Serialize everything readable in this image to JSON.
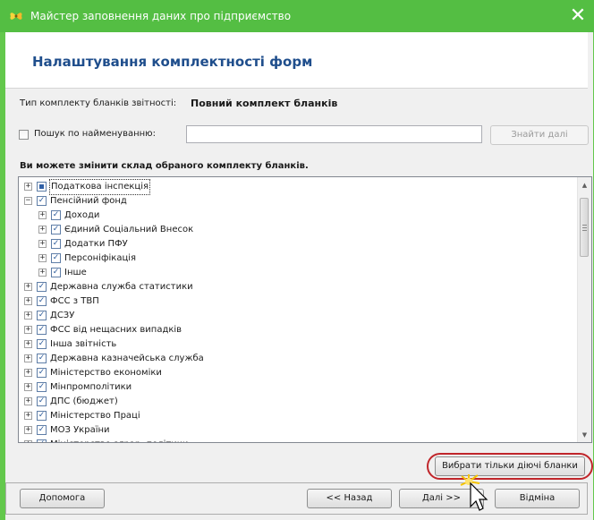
{
  "window": {
    "title": "Майстер заповнення даних про підприємство",
    "close_glyph": "✕",
    "accent_color": "#54be43"
  },
  "header": {
    "title": "Налаштування комплектності форм"
  },
  "kit": {
    "label": "Тип комплекту бланків звітності:",
    "value": "Повний комплект бланків"
  },
  "search": {
    "checkbox_label": "Пошук по найменуванню:",
    "checked": false,
    "input_value": "",
    "find_next_label": "Знайти далі"
  },
  "tree": {
    "heading": "Ви можете змінити склад обраного комплекту бланків.",
    "items": [
      {
        "label": "Податкова інспекція",
        "level": 0,
        "expander": "+",
        "check": "partial",
        "selected": true
      },
      {
        "label": "Пенсійний фонд",
        "level": 0,
        "expander": "−",
        "check": "checked",
        "selected": false
      },
      {
        "label": "Доходи",
        "level": 1,
        "expander": "+",
        "check": "checked",
        "selected": false
      },
      {
        "label": "Єдиний Соціальний Внесок",
        "level": 1,
        "expander": "+",
        "check": "checked",
        "selected": false
      },
      {
        "label": "Додатки ПФУ",
        "level": 1,
        "expander": "+",
        "check": "checked",
        "selected": false
      },
      {
        "label": "Персоніфікація",
        "level": 1,
        "expander": "+",
        "check": "checked",
        "selected": false
      },
      {
        "label": "Інше",
        "level": 1,
        "expander": "+",
        "check": "checked",
        "selected": false
      },
      {
        "label": "Державна служба статистики",
        "level": 0,
        "expander": "+",
        "check": "checked",
        "selected": false
      },
      {
        "label": "ФСС з ТВП",
        "level": 0,
        "expander": "+",
        "check": "checked",
        "selected": false
      },
      {
        "label": "ДСЗУ",
        "level": 0,
        "expander": "+",
        "check": "checked",
        "selected": false
      },
      {
        "label": "ФСС від нещасних випадків",
        "level": 0,
        "expander": "+",
        "check": "checked",
        "selected": false
      },
      {
        "label": "Інша звітність",
        "level": 0,
        "expander": "+",
        "check": "checked",
        "selected": false
      },
      {
        "label": "Державна казначейська служба",
        "level": 0,
        "expander": "+",
        "check": "checked",
        "selected": false
      },
      {
        "label": "Міністерство економіки",
        "level": 0,
        "expander": "+",
        "check": "checked",
        "selected": false
      },
      {
        "label": "Мінпромполітики",
        "level": 0,
        "expander": "+",
        "check": "checked",
        "selected": false
      },
      {
        "label": "ДПС (бюджет)",
        "level": 0,
        "expander": "+",
        "check": "checked",
        "selected": false
      },
      {
        "label": "Міністерство Праці",
        "level": 0,
        "expander": "+",
        "check": "checked",
        "selected": false
      },
      {
        "label": "МОЗ України",
        "level": 0,
        "expander": "+",
        "check": "checked",
        "selected": false
      },
      {
        "label": "Міністерство аграр. політики",
        "level": 0,
        "expander": "+",
        "check": "checked",
        "selected": false
      }
    ],
    "scroll_up_glyph": "▲",
    "scroll_down_glyph": "▼"
  },
  "actions": {
    "select_active_label": "Вибрати тільки діючі бланки",
    "highlight_color": "#c0262b"
  },
  "footer": {
    "help_label": "Допомога",
    "back_label": "<< Назад",
    "next_label": "Далі >>",
    "cancel_label": "Відміна"
  },
  "icons": {
    "app_logo": "butterfly-logo-icon",
    "cursor": "mouse-pointer-icon"
  }
}
